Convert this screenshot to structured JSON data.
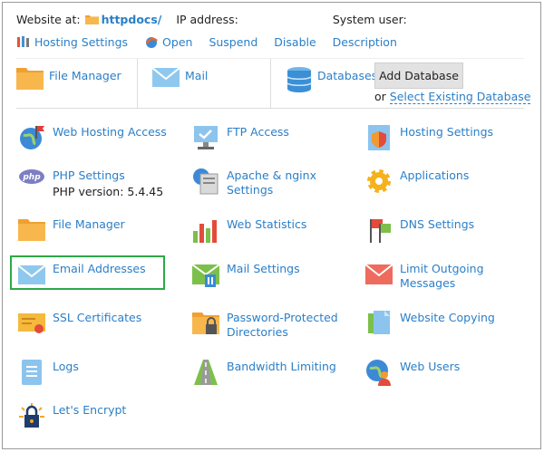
{
  "header": {
    "website_label": "Website at:",
    "site_name": "httpdocs/",
    "ip_label": "IP address:",
    "user_label": "System user:"
  },
  "actions": [
    {
      "label": "Hosting Settings",
      "icon": "wrench-icon"
    },
    {
      "label": "Open",
      "icon": "open-icon"
    },
    {
      "label": "Suspend"
    },
    {
      "label": "Disable"
    },
    {
      "label": "Description"
    }
  ],
  "quick": {
    "file_manager": "File Manager",
    "mail": "Mail",
    "databases": "Databases",
    "add_database": "Add Database",
    "or_text": "or",
    "select_existing": "Select Existing Database"
  },
  "tiles": [
    {
      "label": "Web Hosting Access",
      "icon": "globe-flag-icon"
    },
    {
      "label": "FTP Access",
      "icon": "ftp-monitor-icon"
    },
    {
      "label": "Hosting Settings",
      "icon": "document-shield-icon"
    },
    {
      "label": "PHP Settings",
      "sub": "PHP version: 5.4.45",
      "icon": "php-icon"
    },
    {
      "label": "Apache & nginx Settings",
      "icon": "server-globe-icon"
    },
    {
      "label": "Applications",
      "icon": "gear-icon"
    },
    {
      "label": "File Manager",
      "icon": "folder-icon"
    },
    {
      "label": "Web Statistics",
      "icon": "bar-chart-icon"
    },
    {
      "label": "DNS Settings",
      "icon": "dns-flags-icon"
    },
    {
      "label": "Email Addresses",
      "icon": "envelope-icon"
    },
    {
      "label": "Mail Settings",
      "icon": "mail-settings-icon"
    },
    {
      "label": "Limit Outgoing Messages",
      "icon": "envelope-red-icon"
    },
    {
      "label": "SSL Certificates",
      "icon": "certificate-icon"
    },
    {
      "label": "Password-Protected Directories",
      "icon": "folder-lock-icon"
    },
    {
      "label": "Website Copying",
      "icon": "copy-pages-icon"
    },
    {
      "label": "Logs",
      "icon": "logs-icon"
    },
    {
      "label": "Bandwidth Limiting",
      "icon": "road-icon"
    },
    {
      "label": "Web Users",
      "icon": "web-user-icon"
    },
    {
      "label": "Let's Encrypt",
      "icon": "lock-sun-icon"
    }
  ],
  "colors": {
    "link": "#2a7fc8",
    "highlight": "#2ea84a"
  }
}
